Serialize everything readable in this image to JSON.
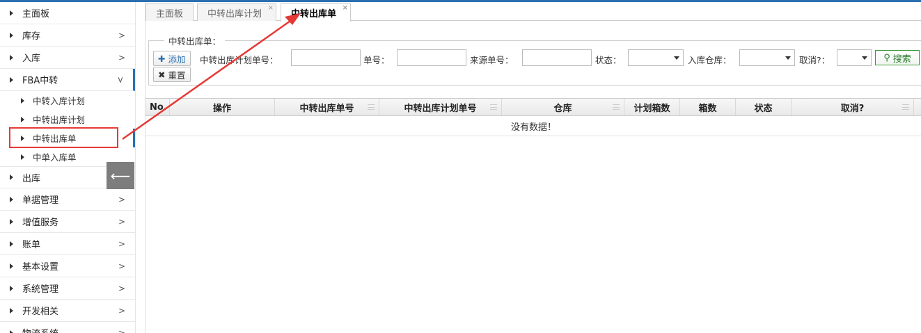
{
  "sidebar": {
    "items": [
      {
        "label": "主面板",
        "has_chevron": false
      },
      {
        "label": "库存",
        "has_chevron": true
      },
      {
        "label": "入库",
        "has_chevron": true
      },
      {
        "label": "FBA中转",
        "has_chevron": true,
        "open": true
      },
      {
        "label": "出库",
        "has_chevron": true
      },
      {
        "label": "单据管理",
        "has_chevron": true
      },
      {
        "label": "增值服务",
        "has_chevron": true
      },
      {
        "label": "账单",
        "has_chevron": true
      },
      {
        "label": "基本设置",
        "has_chevron": true
      },
      {
        "label": "系统管理",
        "has_chevron": true
      },
      {
        "label": "开发相关",
        "has_chevron": true
      },
      {
        "label": "物流系统",
        "has_chevron": true
      }
    ],
    "sub_items": [
      {
        "label": "中转入库计划"
      },
      {
        "label": "中转出库计划"
      },
      {
        "label": "中转出库单",
        "active": true
      },
      {
        "label": "中单入库单"
      }
    ],
    "collapse_icon": "arrow-left-icon"
  },
  "tabs": [
    {
      "label": "主面板",
      "closable": false
    },
    {
      "label": "中转出库计划",
      "closable": true
    },
    {
      "label": "中转出库单",
      "closable": true,
      "active": true
    }
  ],
  "tab_close_glyph": "×",
  "filter": {
    "legend": "中转出库单：",
    "add_label": "添加",
    "reset_label": "重置",
    "plan_no_label": "中转出库计划单号：",
    "order_no_label": "单号：",
    "source_no_label": "来源单号：",
    "status_label": "状态：",
    "warehouse_label": "入库仓库：",
    "cancel_label": "取消?：",
    "search_label": "搜索"
  },
  "grid": {
    "columns": [
      "No.",
      "操作",
      "中转出库单号",
      "中转出库计划单号",
      "仓库",
      "计划箱数",
      "箱数",
      "状态",
      "取消?"
    ],
    "empty_text": "没有数据！"
  },
  "colors": {
    "accent": "#2a6fb0",
    "highlight": "#e53935",
    "search": "#2a7a2a"
  }
}
